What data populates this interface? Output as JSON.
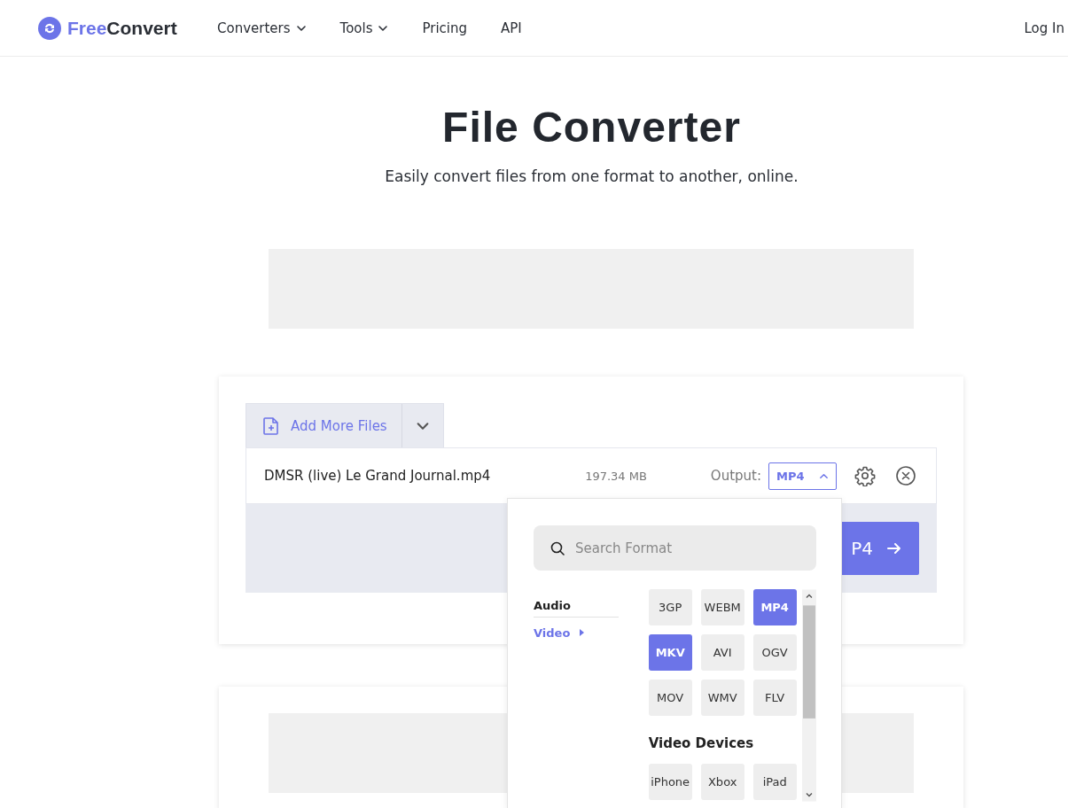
{
  "header": {
    "logo": {
      "first": "Free",
      "second": "Convert"
    },
    "nav": [
      {
        "label": "Converters",
        "has_menu": true
      },
      {
        "label": "Tools",
        "has_menu": true
      },
      {
        "label": "Pricing",
        "has_menu": false
      },
      {
        "label": "API",
        "has_menu": false
      }
    ],
    "login": "Log In"
  },
  "hero": {
    "title": "File Converter",
    "subtitle": "Easily convert files from one format to another, online."
  },
  "uploader": {
    "add_button": "Add More Files",
    "file": {
      "name": "DMSR (live) Le Grand Journal.mp4",
      "size": "197.34 MB",
      "output_label": "Output:",
      "format": "MP4",
      "menu_open": true
    },
    "convert_button": "P4"
  },
  "format_menu": {
    "search": {
      "placeholder": "Search Format"
    },
    "categories": [
      {
        "label": "Audio",
        "selected": false
      },
      {
        "label": "Video",
        "selected": true
      }
    ],
    "sections": [
      {
        "formats": [
          {
            "label": "3GP",
            "highlighted": false
          },
          {
            "label": "WEBM",
            "highlighted": false
          },
          {
            "label": "MP4",
            "highlighted": true
          },
          {
            "label": "MKV",
            "highlighted": true
          },
          {
            "label": "AVI",
            "highlighted": false
          },
          {
            "label": "OGV",
            "highlighted": false
          },
          {
            "label": "MOV",
            "highlighted": false
          },
          {
            "label": "WMV",
            "highlighted": false
          },
          {
            "label": "FLV",
            "highlighted": false
          }
        ]
      },
      {
        "title": "Video Devices",
        "formats": [
          {
            "label": "iPhone",
            "highlighted": false
          },
          {
            "label": "Xbox",
            "highlighted": false
          },
          {
            "label": "iPad",
            "highlighted": false
          }
        ]
      }
    ]
  }
}
